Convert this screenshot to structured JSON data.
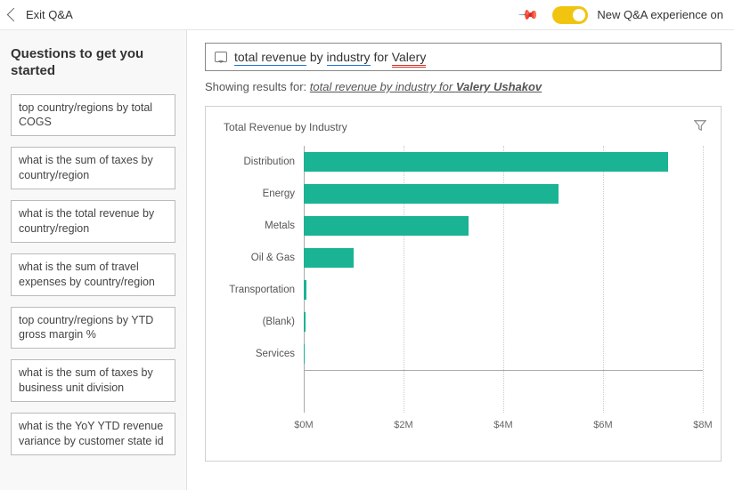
{
  "topbar": {
    "back_label": "Exit Q&A",
    "toggle_label": "New Q&A experience on"
  },
  "sidebar": {
    "title": "Questions to get you started",
    "items": [
      "top country/regions by total COGS",
      "what is the sum of taxes by country/region",
      "what is the total revenue by country/region",
      "what is the sum of travel expenses by country/region",
      "top country/regions by YTD gross margin %",
      "what is the sum of taxes by business unit division",
      "what is the YoY YTD revenue variance by customer state id"
    ]
  },
  "query": {
    "seg1": "total revenue",
    "seg2": " by ",
    "seg3": "industry",
    "seg4": " for ",
    "seg5": "Valery"
  },
  "showing": {
    "prefix": "Showing results for: ",
    "phrase": "total revenue by industry for ",
    "bold": "Valery Ushakov"
  },
  "chart_data": {
    "type": "bar",
    "title": "Total Revenue by Industry",
    "orientation": "horizontal",
    "categories": [
      "Distribution",
      "Energy",
      "Metals",
      "Oil & Gas",
      "Transportation",
      "(Blank)",
      "Services"
    ],
    "values": [
      7.3,
      5.1,
      3.3,
      1.0,
      0.06,
      0.03,
      0.01
    ],
    "xlabel": "",
    "ylabel": "",
    "xlim": [
      0,
      8
    ],
    "x_ticks": [
      0,
      2,
      4,
      6,
      8
    ],
    "x_tick_labels": [
      "$0M",
      "$2M",
      "$4M",
      "$6M",
      "$8M"
    ],
    "color": "#1ab394"
  }
}
